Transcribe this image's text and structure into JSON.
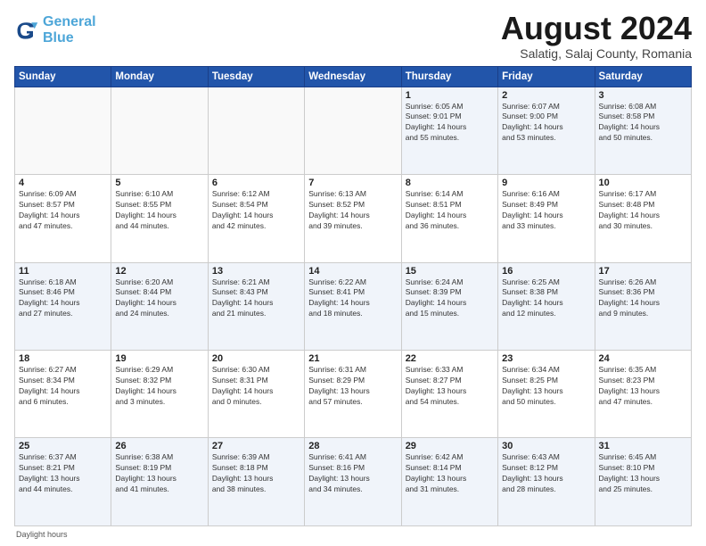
{
  "brand": {
    "name_general": "General",
    "name_blue": "Blue"
  },
  "title": "August 2024",
  "subtitle": "Salatig, Salaj County, Romania",
  "days_of_week": [
    "Sunday",
    "Monday",
    "Tuesday",
    "Wednesday",
    "Thursday",
    "Friday",
    "Saturday"
  ],
  "footer_label": "Daylight hours",
  "weeks": [
    [
      {
        "day": "",
        "info": ""
      },
      {
        "day": "",
        "info": ""
      },
      {
        "day": "",
        "info": ""
      },
      {
        "day": "",
        "info": ""
      },
      {
        "day": "1",
        "info": "Sunrise: 6:05 AM\nSunset: 9:01 PM\nDaylight: 14 hours\nand 55 minutes."
      },
      {
        "day": "2",
        "info": "Sunrise: 6:07 AM\nSunset: 9:00 PM\nDaylight: 14 hours\nand 53 minutes."
      },
      {
        "day": "3",
        "info": "Sunrise: 6:08 AM\nSunset: 8:58 PM\nDaylight: 14 hours\nand 50 minutes."
      }
    ],
    [
      {
        "day": "4",
        "info": "Sunrise: 6:09 AM\nSunset: 8:57 PM\nDaylight: 14 hours\nand 47 minutes."
      },
      {
        "day": "5",
        "info": "Sunrise: 6:10 AM\nSunset: 8:55 PM\nDaylight: 14 hours\nand 44 minutes."
      },
      {
        "day": "6",
        "info": "Sunrise: 6:12 AM\nSunset: 8:54 PM\nDaylight: 14 hours\nand 42 minutes."
      },
      {
        "day": "7",
        "info": "Sunrise: 6:13 AM\nSunset: 8:52 PM\nDaylight: 14 hours\nand 39 minutes."
      },
      {
        "day": "8",
        "info": "Sunrise: 6:14 AM\nSunset: 8:51 PM\nDaylight: 14 hours\nand 36 minutes."
      },
      {
        "day": "9",
        "info": "Sunrise: 6:16 AM\nSunset: 8:49 PM\nDaylight: 14 hours\nand 33 minutes."
      },
      {
        "day": "10",
        "info": "Sunrise: 6:17 AM\nSunset: 8:48 PM\nDaylight: 14 hours\nand 30 minutes."
      }
    ],
    [
      {
        "day": "11",
        "info": "Sunrise: 6:18 AM\nSunset: 8:46 PM\nDaylight: 14 hours\nand 27 minutes."
      },
      {
        "day": "12",
        "info": "Sunrise: 6:20 AM\nSunset: 8:44 PM\nDaylight: 14 hours\nand 24 minutes."
      },
      {
        "day": "13",
        "info": "Sunrise: 6:21 AM\nSunset: 8:43 PM\nDaylight: 14 hours\nand 21 minutes."
      },
      {
        "day": "14",
        "info": "Sunrise: 6:22 AM\nSunset: 8:41 PM\nDaylight: 14 hours\nand 18 minutes."
      },
      {
        "day": "15",
        "info": "Sunrise: 6:24 AM\nSunset: 8:39 PM\nDaylight: 14 hours\nand 15 minutes."
      },
      {
        "day": "16",
        "info": "Sunrise: 6:25 AM\nSunset: 8:38 PM\nDaylight: 14 hours\nand 12 minutes."
      },
      {
        "day": "17",
        "info": "Sunrise: 6:26 AM\nSunset: 8:36 PM\nDaylight: 14 hours\nand 9 minutes."
      }
    ],
    [
      {
        "day": "18",
        "info": "Sunrise: 6:27 AM\nSunset: 8:34 PM\nDaylight: 14 hours\nand 6 minutes."
      },
      {
        "day": "19",
        "info": "Sunrise: 6:29 AM\nSunset: 8:32 PM\nDaylight: 14 hours\nand 3 minutes."
      },
      {
        "day": "20",
        "info": "Sunrise: 6:30 AM\nSunset: 8:31 PM\nDaylight: 14 hours\nand 0 minutes."
      },
      {
        "day": "21",
        "info": "Sunrise: 6:31 AM\nSunset: 8:29 PM\nDaylight: 13 hours\nand 57 minutes."
      },
      {
        "day": "22",
        "info": "Sunrise: 6:33 AM\nSunset: 8:27 PM\nDaylight: 13 hours\nand 54 minutes."
      },
      {
        "day": "23",
        "info": "Sunrise: 6:34 AM\nSunset: 8:25 PM\nDaylight: 13 hours\nand 50 minutes."
      },
      {
        "day": "24",
        "info": "Sunrise: 6:35 AM\nSunset: 8:23 PM\nDaylight: 13 hours\nand 47 minutes."
      }
    ],
    [
      {
        "day": "25",
        "info": "Sunrise: 6:37 AM\nSunset: 8:21 PM\nDaylight: 13 hours\nand 44 minutes."
      },
      {
        "day": "26",
        "info": "Sunrise: 6:38 AM\nSunset: 8:19 PM\nDaylight: 13 hours\nand 41 minutes."
      },
      {
        "day": "27",
        "info": "Sunrise: 6:39 AM\nSunset: 8:18 PM\nDaylight: 13 hours\nand 38 minutes."
      },
      {
        "day": "28",
        "info": "Sunrise: 6:41 AM\nSunset: 8:16 PM\nDaylight: 13 hours\nand 34 minutes."
      },
      {
        "day": "29",
        "info": "Sunrise: 6:42 AM\nSunset: 8:14 PM\nDaylight: 13 hours\nand 31 minutes."
      },
      {
        "day": "30",
        "info": "Sunrise: 6:43 AM\nSunset: 8:12 PM\nDaylight: 13 hours\nand 28 minutes."
      },
      {
        "day": "31",
        "info": "Sunrise: 6:45 AM\nSunset: 8:10 PM\nDaylight: 13 hours\nand 25 minutes."
      }
    ]
  ]
}
